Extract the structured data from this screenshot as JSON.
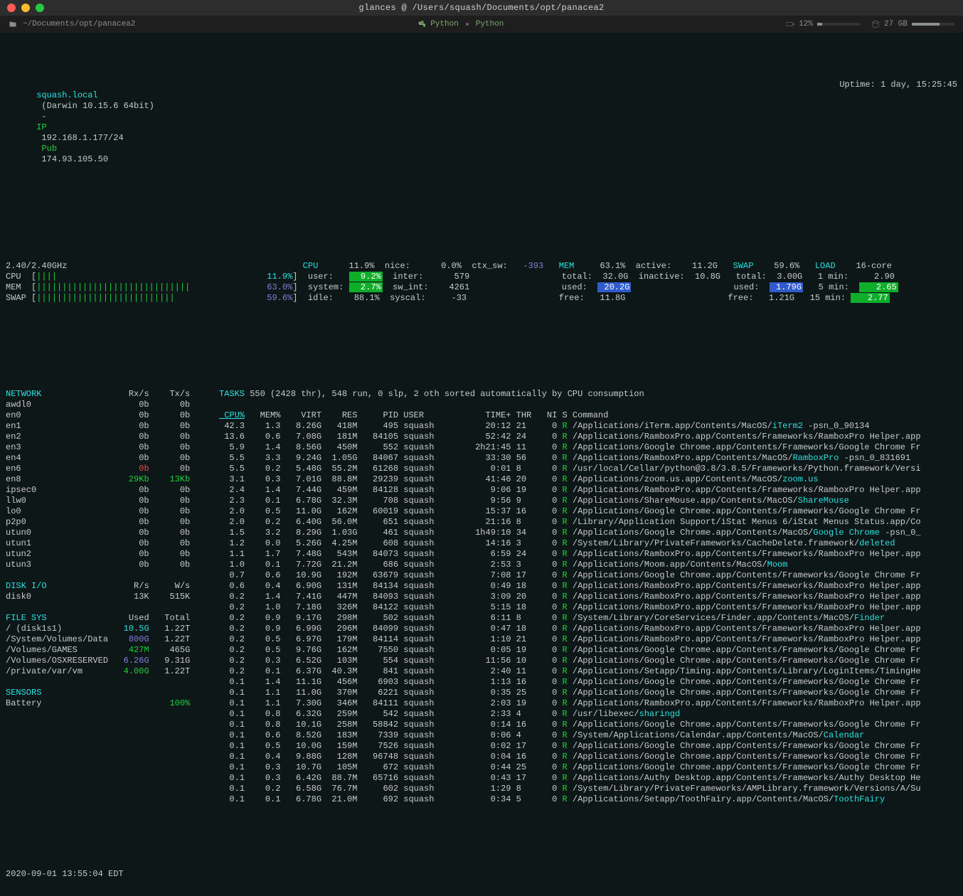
{
  "window": {
    "title": "glances  @  /Users/squash/Documents/opt/panacea2",
    "pathbar": {
      "path": "~/Documents/opt/panacea2",
      "lang1": "Python",
      "lang2": "Python",
      "batt_pct": 12,
      "batt_label": "12%",
      "disk_label": "27 GB"
    }
  },
  "sys": {
    "host": "squash.local",
    "os": "(Darwin 10.15.6 64bit)",
    "ip_label": "IP",
    "ip": "192.168.1.177/24",
    "pub_label": "Pub",
    "pub_ip": "174.93.105.50",
    "uptime": "Uptime: 1 day, 15:25:45"
  },
  "quickbars": {
    "freq": "2.40/2.40GHz",
    "cpu_bar": "CPU  [||||                                           11.9%]",
    "mem_bar": "MEM  [||||||||||||||||||||||||||||||                 63.0%]",
    "swap_bar": "SWAP [|||||||||||||||||||||||||||                    59.6%]"
  },
  "cpu": {
    "title": "CPU",
    "total_pct": "11.9%",
    "rows": [
      {
        "l": "user:",
        "rv": "9.2%",
        "hl": "green"
      },
      {
        "l": "system:",
        "rv": "2.7%",
        "hl": "green"
      },
      {
        "l": "idle:",
        "rv": "88.1%"
      }
    ],
    "col2": [
      {
        "l": "nice:",
        "rv": "0.0%"
      },
      {
        "l": "inter:",
        "rv": "579"
      },
      {
        "l": "sw_int:",
        "rv": "4261"
      },
      {
        "l": "syscal:",
        "rv": "-33"
      }
    ],
    "ctx": {
      "l": "ctx_sw:",
      "rv": "-393"
    }
  },
  "mem": {
    "title": "MEM",
    "pct": "63.1%",
    "rows": [
      {
        "l": "total:",
        "rv": "32.0G"
      },
      {
        "l": "used:",
        "rv": "20.2G",
        "hl": "blue"
      },
      {
        "l": "free:",
        "rv": "11.8G"
      }
    ],
    "col2": [
      {
        "l": "active:",
        "rv": "11.2G"
      },
      {
        "l": "inactive:",
        "rv": "10.8G"
      }
    ]
  },
  "swap": {
    "title": "SWAP",
    "pct": "59.6%",
    "rows": [
      {
        "l": "total:",
        "rv": "3.00G"
      },
      {
        "l": "used:",
        "rv": "1.79G",
        "hl": "blue"
      },
      {
        "l": "free:",
        "rv": "1.21G"
      }
    ]
  },
  "load": {
    "title": "LOAD",
    "cores": "16-core",
    "rows": [
      {
        "l": "1 min:",
        "rv": "2.90"
      },
      {
        "l": "5 min:",
        "rv": "2.65",
        "hl": "green"
      },
      {
        "l": "15 min:",
        "rv": "2.77",
        "hl": "green"
      }
    ]
  },
  "network": {
    "title": "NETWORK",
    "h_rx": "Rx/s",
    "h_tx": "Tx/s",
    "rows": [
      {
        "if": "awdl0",
        "rx": "0b",
        "tx": "0b"
      },
      {
        "if": "en0",
        "rx": "0b",
        "tx": "0b"
      },
      {
        "if": "en1",
        "rx": "0b",
        "tx": "0b"
      },
      {
        "if": "en2",
        "rx": "0b",
        "tx": "0b"
      },
      {
        "if": "en3",
        "rx": "0b",
        "tx": "0b"
      },
      {
        "if": "en4",
        "rx": "0b",
        "tx": "0b"
      },
      {
        "if": "en6",
        "rx": "0b",
        "tx": "0b",
        "rxc": "red"
      },
      {
        "if": "en8",
        "rx": "29Kb",
        "tx": "13Kb",
        "rxc": "green",
        "txc": "green"
      },
      {
        "if": "ipsec0",
        "rx": "0b",
        "tx": "0b"
      },
      {
        "if": "llw0",
        "rx": "0b",
        "tx": "0b"
      },
      {
        "if": "lo0",
        "rx": "0b",
        "tx": "0b"
      },
      {
        "if": "p2p0",
        "rx": "0b",
        "tx": "0b"
      },
      {
        "if": "utun0",
        "rx": "0b",
        "tx": "0b"
      },
      {
        "if": "utun1",
        "rx": "0b",
        "tx": "0b"
      },
      {
        "if": "utun2",
        "rx": "0b",
        "tx": "0b"
      },
      {
        "if": "utun3",
        "rx": "0b",
        "tx": "0b"
      }
    ]
  },
  "disk": {
    "title": "DISK I/O",
    "h_r": "R/s",
    "h_w": "W/s",
    "rows": [
      {
        "d": "disk0",
        "r": "13K",
        "w": "515K"
      }
    ]
  },
  "fs": {
    "title": "FILE SYS",
    "h_u": "Used",
    "h_t": "Total",
    "rows": [
      {
        "m": "/ (disk1s1)",
        "u": "10.5G",
        "t": "1.22T",
        "uc": "cyan"
      },
      {
        "m": "/System/Volumes/Data",
        "u": "800G",
        "t": "1.22T",
        "uc": "purple"
      },
      {
        "m": "/Volumes/GAMES",
        "u": "427M",
        "t": "465G",
        "uc": "green"
      },
      {
        "m": "/Volumes/OSXRESERVED",
        "u": "6.26G",
        "t": "9.31G",
        "uc": "purple"
      },
      {
        "m": "/private/var/vm",
        "u": "4.00G",
        "t": "1.22T",
        "uc": "green"
      }
    ]
  },
  "sensors": {
    "title": "SENSORS",
    "rows": [
      {
        "n": "Battery",
        "v": "100%",
        "vc": "green"
      }
    ]
  },
  "tasks": {
    "summary": "TASKS 550 (2428 thr), 548 run, 0 slp, 2 oth sorted automatically by CPU consumption",
    "header": {
      "cpu": "CPU%",
      "mem": "MEM%",
      "virt": "VIRT",
      "res": "RES",
      "pid": "PID",
      "user": "USER",
      "time": "TIME+",
      "thr": "THR",
      "ni": "NI",
      "s": "S",
      "cmd": "Command"
    },
    "rows": [
      {
        "cpu": "42.3",
        "cpuc": "o",
        "mem": "1.3",
        "virt": "8.26G",
        "res": "418M",
        "pid": "495",
        "user": "squash",
        "time": "20:12",
        "thr": "21",
        "ni": "0",
        "s": "R",
        "cmd": "/Applications/iTerm.app/Contents/MacOS/",
        "cmdh": "iTerm2",
        "cmdt": " -psn_0_90134"
      },
      {
        "cpu": "13.6",
        "cpuc": "g",
        "mem": "0.6",
        "virt": "7.08G",
        "res": "181M",
        "pid": "84105",
        "user": "squash",
        "time": "52:42",
        "thr": "24",
        "ni": "0",
        "s": "R",
        "cmd": "/Applications/RamboxPro.app/Contents/Frameworks/RamboxPro Helper.app"
      },
      {
        "cpu": "5.9",
        "cpuc": "g",
        "mem": "1.4",
        "memc": "y",
        "virt": "8.56G",
        "res": "450M",
        "pid": "552",
        "user": "squash",
        "time": "2h21:45",
        "timec": "o",
        "thr": "11",
        "ni": "0",
        "s": "R",
        "cmd": "/Applications/Google Chrome.app/Contents/Frameworks/Google Chrome Fr"
      },
      {
        "cpu": "5.5",
        "cpuc": "g",
        "mem": "3.3",
        "memc": "y",
        "virt": "9.24G",
        "res": "1.05G",
        "pid": "84067",
        "user": "squash",
        "time": "33:30",
        "thr": "56",
        "ni": "0",
        "s": "R",
        "cmd": "/Applications/RamboxPro.app/Contents/MacOS/",
        "cmdh": "RamboxPro",
        "cmdt": " -psn_0_831691"
      },
      {
        "cpu": "5.5",
        "cpuc": "g",
        "mem": "0.2",
        "virt": "5.48G",
        "res": "55.2M",
        "pid": "61268",
        "user": "squash",
        "time": "0:01",
        "thr": "8",
        "ni": "0",
        "s": "R",
        "cmd": "/usr/local/Cellar/python@3.8/3.8.5/Frameworks/Python.framework/Versi"
      },
      {
        "cpu": "3.1",
        "cpuc": "g",
        "mem": "0.3",
        "virt": "7.01G",
        "res": "88.8M",
        "pid": "29239",
        "user": "squash",
        "time": "41:46",
        "thr": "20",
        "ni": "0",
        "s": "R",
        "cmd": "/Applications/zoom.us.app/Contents/MacOS/",
        "cmdh": "zoom.us"
      },
      {
        "cpu": "2.4",
        "cpuc": "g",
        "mem": "1.4",
        "memc": "y",
        "virt": "7.44G",
        "res": "459M",
        "pid": "84128",
        "user": "squash",
        "time": "9:06",
        "thr": "19",
        "ni": "0",
        "s": "R",
        "cmd": "/Applications/RamboxPro.app/Contents/Frameworks/RamboxPro Helper.app"
      },
      {
        "cpu": "2.3",
        "cpuc": "g",
        "mem": "0.1",
        "virt": "6.78G",
        "res": "32.3M",
        "pid": "708",
        "user": "squash",
        "time": "9:56",
        "thr": "9",
        "ni": "0",
        "s": "R",
        "cmd": "/Applications/ShareMouse.app/Contents/MacOS/",
        "cmdh": "ShareMouse"
      },
      {
        "cpu": "2.0",
        "cpuc": "g",
        "mem": "0.5",
        "virt": "11.0G",
        "res": "162M",
        "pid": "60019",
        "user": "squash",
        "time": "15:37",
        "thr": "16",
        "ni": "0",
        "s": "R",
        "cmd": "/Applications/Google Chrome.app/Contents/Frameworks/Google Chrome Fr"
      },
      {
        "cpu": "2.0",
        "cpuc": "g",
        "mem": "0.2",
        "virt": "6.40G",
        "res": "56.0M",
        "pid": "651",
        "user": "squash",
        "time": "21:16",
        "thr": "8",
        "ni": "0",
        "s": "R",
        "cmd": "/Library/Application Support/iStat Menus 6/iStat Menus Status.app/Co"
      },
      {
        "cpu": "1.5",
        "cpuc": "g",
        "mem": "3.2",
        "memc": "y",
        "virt": "8.29G",
        "res": "1.03G",
        "pid": "461",
        "user": "squash",
        "time": "1h49:10",
        "timec": "o",
        "thr": "34",
        "ni": "0",
        "s": "R",
        "cmd": "/Applications/Google Chrome.app/Contents/MacOS/",
        "cmdh": "Google Chrome",
        "cmdt": " -psn_0_"
      },
      {
        "cpu": "1.2",
        "cpuc": "g",
        "mem": "0.0",
        "virt": "5.26G",
        "res": "4.25M",
        "pid": "608",
        "user": "squash",
        "time": "14:16",
        "thr": "3",
        "ni": "0",
        "s": "R",
        "cmd": "/System/Library/PrivateFrameworks/CacheDelete.framework/",
        "cmdh": "deleted"
      },
      {
        "cpu": "1.1",
        "cpuc": "g",
        "mem": "1.7",
        "memc": "y",
        "virt": "7.48G",
        "res": "543M",
        "pid": "84073",
        "user": "squash",
        "time": "6:59",
        "thr": "24",
        "ni": "0",
        "s": "R",
        "cmd": "/Applications/RamboxPro.app/Contents/Frameworks/RamboxPro Helper.app"
      },
      {
        "cpu": "1.0",
        "cpuc": "g",
        "mem": "0.1",
        "virt": "7.72G",
        "res": "21.2M",
        "pid": "686",
        "user": "squash",
        "time": "2:53",
        "thr": "3",
        "ni": "0",
        "s": "R",
        "cmd": "/Applications/Moom.app/Contents/MacOS/",
        "cmdh": "Moom"
      },
      {
        "cpu": "0.7",
        "cpuc": "g",
        "mem": "0.6",
        "virt": "10.9G",
        "res": "192M",
        "pid": "63679",
        "user": "squash",
        "time": "7:08",
        "thr": "17",
        "ni": "0",
        "s": "R",
        "cmd": "/Applications/Google Chrome.app/Contents/Frameworks/Google Chrome Fr"
      },
      {
        "cpu": "0.6",
        "cpuc": "g",
        "mem": "0.4",
        "virt": "6.90G",
        "res": "131M",
        "pid": "84134",
        "user": "squash",
        "time": "0:49",
        "thr": "18",
        "ni": "0",
        "s": "R",
        "cmd": "/Applications/RamboxPro.app/Contents/Frameworks/RamboxPro Helper.app"
      },
      {
        "cpu": "0.2",
        "cpuc": "g",
        "mem": "1.4",
        "memc": "y",
        "virt": "7.41G",
        "res": "447M",
        "pid": "84093",
        "user": "squash",
        "time": "3:09",
        "thr": "20",
        "ni": "0",
        "s": "R",
        "cmd": "/Applications/RamboxPro.app/Contents/Frameworks/RamboxPro Helper.app"
      },
      {
        "cpu": "0.2",
        "cpuc": "g",
        "mem": "1.0",
        "virt": "7.18G",
        "res": "326M",
        "pid": "84122",
        "user": "squash",
        "time": "5:15",
        "thr": "18",
        "ni": "0",
        "s": "R",
        "cmd": "/Applications/RamboxPro.app/Contents/Frameworks/RamboxPro Helper.app"
      },
      {
        "cpu": "0.2",
        "cpuc": "g",
        "mem": "0.9",
        "virt": "9.17G",
        "res": "298M",
        "pid": "502",
        "user": "squash",
        "time": "6:11",
        "thr": "8",
        "ni": "0",
        "s": "R",
        "cmd": "/System/Library/CoreServices/Finder.app/Contents/MacOS/",
        "cmdh": "Finder"
      },
      {
        "cpu": "0.2",
        "cpuc": "g",
        "mem": "0.9",
        "virt": "6.99G",
        "res": "296M",
        "pid": "84099",
        "user": "squash",
        "time": "0:47",
        "thr": "18",
        "ni": "0",
        "s": "R",
        "cmd": "/Applications/RamboxPro.app/Contents/Frameworks/RamboxPro Helper.app"
      },
      {
        "cpu": "0.2",
        "cpuc": "g",
        "mem": "0.5",
        "virt": "6.97G",
        "res": "179M",
        "pid": "84114",
        "user": "squash",
        "time": "1:10",
        "thr": "21",
        "ni": "0",
        "s": "R",
        "cmd": "/Applications/RamboxPro.app/Contents/Frameworks/RamboxPro Helper.app"
      },
      {
        "cpu": "0.2",
        "cpuc": "g",
        "mem": "0.5",
        "virt": "9.76G",
        "res": "162M",
        "pid": "7550",
        "user": "squash",
        "time": "0:05",
        "thr": "19",
        "ni": "0",
        "s": "R",
        "cmd": "/Applications/Google Chrome.app/Contents/Frameworks/Google Chrome Fr"
      },
      {
        "cpu": "0.2",
        "cpuc": "g",
        "mem": "0.3",
        "virt": "6.52G",
        "res": "103M",
        "pid": "554",
        "user": "squash",
        "time": "11:56",
        "thr": "10",
        "ni": "0",
        "s": "R",
        "cmd": "/Applications/Google Chrome.app/Contents/Frameworks/Google Chrome Fr"
      },
      {
        "cpu": "0.2",
        "cpuc": "g",
        "mem": "0.1",
        "virt": "6.37G",
        "res": "40.3M",
        "pid": "841",
        "user": "squash",
        "time": "2:40",
        "thr": "11",
        "ni": "0",
        "s": "R",
        "cmd": "/Applications/Setapp/Timing.app/Contents/Library/LoginItems/TimingHe"
      },
      {
        "cpu": "0.1",
        "cpuc": "g",
        "mem": "1.4",
        "memc": "y",
        "virt": "11.1G",
        "res": "456M",
        "pid": "6903",
        "user": "squash",
        "time": "1:13",
        "thr": "16",
        "ni": "0",
        "s": "R",
        "cmd": "/Applications/Google Chrome.app/Contents/Frameworks/Google Chrome Fr"
      },
      {
        "cpu": "0.1",
        "cpuc": "g",
        "mem": "1.1",
        "memc": "y",
        "virt": "11.0G",
        "res": "370M",
        "pid": "6221",
        "user": "squash",
        "time": "0:35",
        "thr": "25",
        "ni": "0",
        "s": "R",
        "cmd": "/Applications/Google Chrome.app/Contents/Frameworks/Google Chrome Fr"
      },
      {
        "cpu": "0.1",
        "cpuc": "g",
        "mem": "1.1",
        "memc": "y",
        "virt": "7.30G",
        "res": "346M",
        "pid": "84111",
        "user": "squash",
        "time": "2:03",
        "thr": "19",
        "ni": "0",
        "s": "R",
        "cmd": "/Applications/RamboxPro.app/Contents/Frameworks/RamboxPro Helper.app"
      },
      {
        "cpu": "0.1",
        "cpuc": "g",
        "mem": "0.8",
        "virt": "6.32G",
        "res": "259M",
        "pid": "542",
        "user": "squash",
        "time": "2:33",
        "thr": "4",
        "ni": "0",
        "s": "R",
        "cmd": "/usr/libexec/",
        "cmdh": "sharingd"
      },
      {
        "cpu": "0.1",
        "cpuc": "g",
        "mem": "0.8",
        "virt": "10.1G",
        "res": "258M",
        "pid": "58842",
        "user": "squash",
        "time": "0:14",
        "thr": "16",
        "ni": "0",
        "s": "R",
        "cmd": "/Applications/Google Chrome.app/Contents/Frameworks/Google Chrome Fr"
      },
      {
        "cpu": "0.1",
        "cpuc": "g",
        "mem": "0.6",
        "virt": "8.52G",
        "res": "183M",
        "pid": "7339",
        "user": "squash",
        "time": "0:06",
        "thr": "4",
        "ni": "0",
        "s": "R",
        "cmd": "/System/Applications/Calendar.app/Contents/MacOS/",
        "cmdh": "Calendar"
      },
      {
        "cpu": "0.1",
        "cpuc": "g",
        "mem": "0.5",
        "virt": "10.0G",
        "res": "159M",
        "pid": "7526",
        "user": "squash",
        "time": "0:02",
        "thr": "17",
        "ni": "0",
        "s": "R",
        "cmd": "/Applications/Google Chrome.app/Contents/Frameworks/Google Chrome Fr"
      },
      {
        "cpu": "0.1",
        "cpuc": "g",
        "mem": "0.4",
        "virt": "9.88G",
        "res": "128M",
        "pid": "96748",
        "user": "squash",
        "time": "0:04",
        "thr": "16",
        "ni": "0",
        "s": "R",
        "cmd": "/Applications/Google Chrome.app/Contents/Frameworks/Google Chrome Fr"
      },
      {
        "cpu": "0.1",
        "cpuc": "g",
        "mem": "0.3",
        "virt": "10.7G",
        "res": "105M",
        "pid": "672",
        "user": "squash",
        "time": "0:44",
        "thr": "25",
        "ni": "0",
        "s": "R",
        "cmd": "/Applications/Google Chrome.app/Contents/Frameworks/Google Chrome Fr"
      },
      {
        "cpu": "0.1",
        "cpuc": "g",
        "mem": "0.3",
        "virt": "6.42G",
        "res": "88.7M",
        "pid": "65716",
        "user": "squash",
        "time": "0:43",
        "thr": "17",
        "ni": "0",
        "s": "R",
        "cmd": "/Applications/Authy Desktop.app/Contents/Frameworks/Authy Desktop He"
      },
      {
        "cpu": "0.1",
        "cpuc": "g",
        "mem": "0.2",
        "virt": "6.58G",
        "res": "76.7M",
        "pid": "602",
        "user": "squash",
        "time": "1:29",
        "thr": "8",
        "ni": "0",
        "s": "R",
        "cmd": "/System/Library/PrivateFrameworks/AMPLibrary.framework/Versions/A/Su"
      },
      {
        "cpu": "0.1",
        "cpuc": "g",
        "mem": "0.1",
        "virt": "6.78G",
        "res": "21.0M",
        "pid": "692",
        "user": "squash",
        "time": "0:34",
        "thr": "5",
        "ni": "0",
        "s": "R",
        "cmd": "/Applications/Setapp/ToothFairy.app/Contents/MacOS/",
        "cmdh": "ToothFairy"
      }
    ]
  },
  "footer": "2020-09-01 13:55:04 EDT"
}
